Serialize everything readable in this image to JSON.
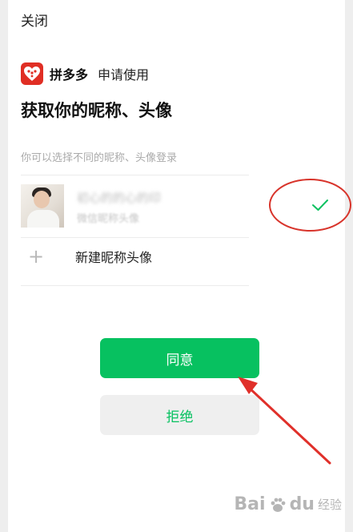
{
  "header": {
    "close_label": "关闭"
  },
  "app": {
    "name": "拼多多",
    "request_text": "申请使用",
    "logo_icon": "pinduoduo-logo",
    "brand_color": "#e02e24"
  },
  "title": "获取你的昵称、头像",
  "hint": "你可以选择不同的昵称、头像登录",
  "accounts": [
    {
      "name": "初心的的心的印",
      "subtitle": "微信昵称头像",
      "selected": true,
      "check_icon": "check-icon"
    }
  ],
  "new_profile": {
    "icon": "plus-icon",
    "label": "新建昵称头像"
  },
  "buttons": {
    "agree_label": "同意",
    "reject_label": "拒绝",
    "agree_color": "#07c160"
  },
  "watermark": {
    "text_left": "Bai",
    "text_right": "du",
    "sub": "经验",
    "icon": "baidu-paw-icon"
  },
  "annotations": {
    "ring_color": "#d8342b",
    "arrow_color": "#e0302a"
  }
}
